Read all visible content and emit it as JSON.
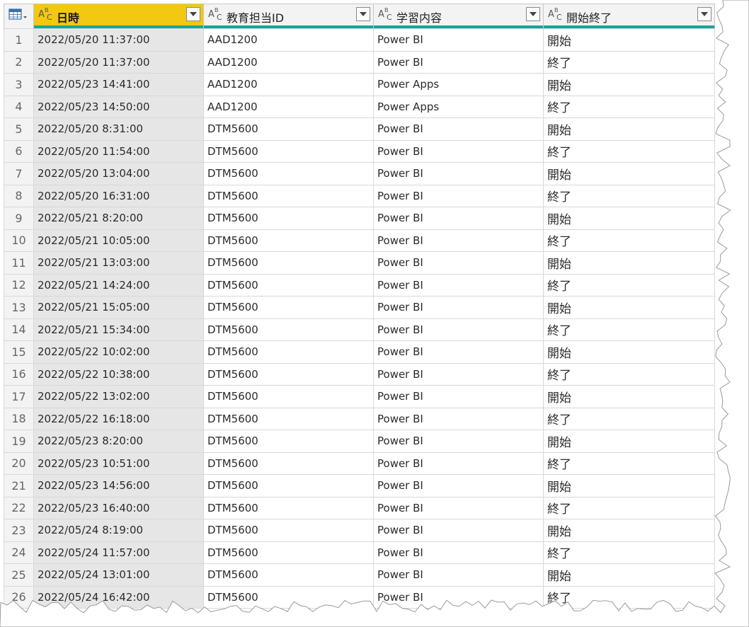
{
  "columns": [
    {
      "type_icon": "text-type-icon",
      "label": "日時",
      "active": true
    },
    {
      "type_icon": "text-type-icon",
      "label": "教育担当ID",
      "active": false
    },
    {
      "type_icon": "text-type-icon",
      "label": "学習内容",
      "active": false
    },
    {
      "type_icon": "text-type-icon",
      "label": "開始終了",
      "active": false
    }
  ],
  "type_icon_text": {
    "a": "A",
    "b": "B",
    "c": "C"
  },
  "accent_color": "#16a59c",
  "active_header_color": "#f2c811",
  "rows": [
    {
      "n": "1",
      "date": "2022/05/20 11:37:00",
      "id": "AAD1200",
      "content": "Power BI",
      "se": "開始"
    },
    {
      "n": "2",
      "date": "2022/05/20 11:37:00",
      "id": "AAD1200",
      "content": "Power BI",
      "se": "終了"
    },
    {
      "n": "3",
      "date": "2022/05/23 14:41:00",
      "id": "AAD1200",
      "content": "Power Apps",
      "se": "開始"
    },
    {
      "n": "4",
      "date": "2022/05/23 14:50:00",
      "id": "AAD1200",
      "content": "Power Apps",
      "se": "終了"
    },
    {
      "n": "5",
      "date": "2022/05/20 8:31:00",
      "id": "DTM5600",
      "content": "Power BI",
      "se": "開始"
    },
    {
      "n": "6",
      "date": "2022/05/20 11:54:00",
      "id": "DTM5600",
      "content": "Power BI",
      "se": "終了"
    },
    {
      "n": "7",
      "date": "2022/05/20 13:04:00",
      "id": "DTM5600",
      "content": "Power BI",
      "se": "開始"
    },
    {
      "n": "8",
      "date": "2022/05/20 16:31:00",
      "id": "DTM5600",
      "content": "Power BI",
      "se": "終了"
    },
    {
      "n": "9",
      "date": "2022/05/21 8:20:00",
      "id": "DTM5600",
      "content": "Power BI",
      "se": "開始"
    },
    {
      "n": "10",
      "date": "2022/05/21 10:05:00",
      "id": "DTM5600",
      "content": "Power BI",
      "se": "終了"
    },
    {
      "n": "11",
      "date": "2022/05/21 13:03:00",
      "id": "DTM5600",
      "content": "Power BI",
      "se": "開始"
    },
    {
      "n": "12",
      "date": "2022/05/21 14:24:00",
      "id": "DTM5600",
      "content": "Power BI",
      "se": "終了"
    },
    {
      "n": "13",
      "date": "2022/05/21 15:05:00",
      "id": "DTM5600",
      "content": "Power BI",
      "se": "開始"
    },
    {
      "n": "14",
      "date": "2022/05/21 15:34:00",
      "id": "DTM5600",
      "content": "Power BI",
      "se": "終了"
    },
    {
      "n": "15",
      "date": "2022/05/22 10:02:00",
      "id": "DTM5600",
      "content": "Power BI",
      "se": "開始"
    },
    {
      "n": "16",
      "date": "2022/05/22 10:38:00",
      "id": "DTM5600",
      "content": "Power BI",
      "se": "終了"
    },
    {
      "n": "17",
      "date": "2022/05/22 13:02:00",
      "id": "DTM5600",
      "content": "Power BI",
      "se": "開始"
    },
    {
      "n": "18",
      "date": "2022/05/22 16:18:00",
      "id": "DTM5600",
      "content": "Power BI",
      "se": "終了"
    },
    {
      "n": "19",
      "date": "2022/05/23 8:20:00",
      "id": "DTM5600",
      "content": "Power BI",
      "se": "開始"
    },
    {
      "n": "20",
      "date": "2022/05/23 10:51:00",
      "id": "DTM5600",
      "content": "Power BI",
      "se": "終了"
    },
    {
      "n": "21",
      "date": "2022/05/23 14:56:00",
      "id": "DTM5600",
      "content": "Power BI",
      "se": "開始"
    },
    {
      "n": "22",
      "date": "2022/05/23 16:40:00",
      "id": "DTM5600",
      "content": "Power BI",
      "se": "終了"
    },
    {
      "n": "23",
      "date": "2022/05/24 8:19:00",
      "id": "DTM5600",
      "content": "Power BI",
      "se": "開始"
    },
    {
      "n": "24",
      "date": "2022/05/24 11:57:00",
      "id": "DTM5600",
      "content": "Power BI",
      "se": "終了"
    },
    {
      "n": "25",
      "date": "2022/05/24 13:01:00",
      "id": "DTM5600",
      "content": "Power BI",
      "se": "開始"
    },
    {
      "n": "26",
      "date": "2022/05/24 16:42:00",
      "id": "DTM5600",
      "content": "Power BI",
      "se": "終了"
    }
  ]
}
